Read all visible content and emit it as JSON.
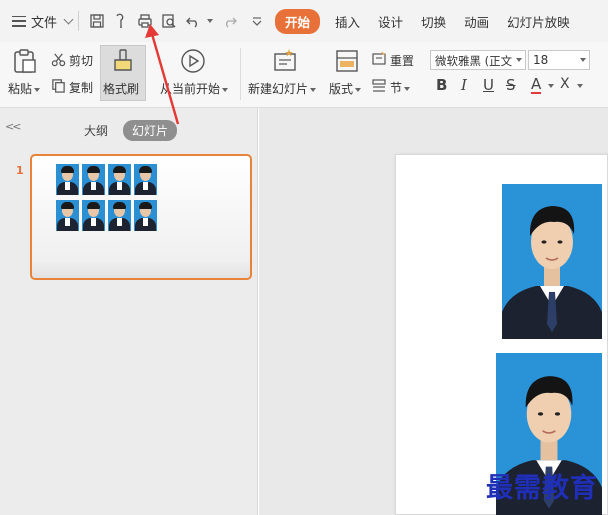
{
  "menubar": {
    "file_label": "文件",
    "tabs": [
      {
        "label": "开始",
        "active": true
      },
      {
        "label": "插入",
        "active": false
      },
      {
        "label": "设计",
        "active": false
      },
      {
        "label": "切换",
        "active": false
      },
      {
        "label": "动画",
        "active": false
      },
      {
        "label": "幻灯片放映",
        "active": false
      }
    ]
  },
  "ribbon": {
    "paste": "粘贴",
    "cut": "剪切",
    "copy": "复制",
    "format_painter": "格式刷",
    "from_current": "从当前开始",
    "new_slide": "新建幻灯片",
    "layout": "版式",
    "reset": "重置",
    "section": "节",
    "font_name": "微软雅黑 (正文",
    "font_size": "18",
    "bold": "B",
    "italic": "I",
    "underline": "U",
    "strike": "S",
    "font_color": "A",
    "clear_format": "X"
  },
  "left_panel": {
    "tab_outline": "大纲",
    "tab_slides": "幻灯片",
    "slide_number": "1"
  },
  "watermark": "最需教育",
  "colors": {
    "accent": "#e8713a",
    "photo_bg": "#2a93d8",
    "arrow": "#e53935",
    "watermark": "#1f2fb8"
  }
}
